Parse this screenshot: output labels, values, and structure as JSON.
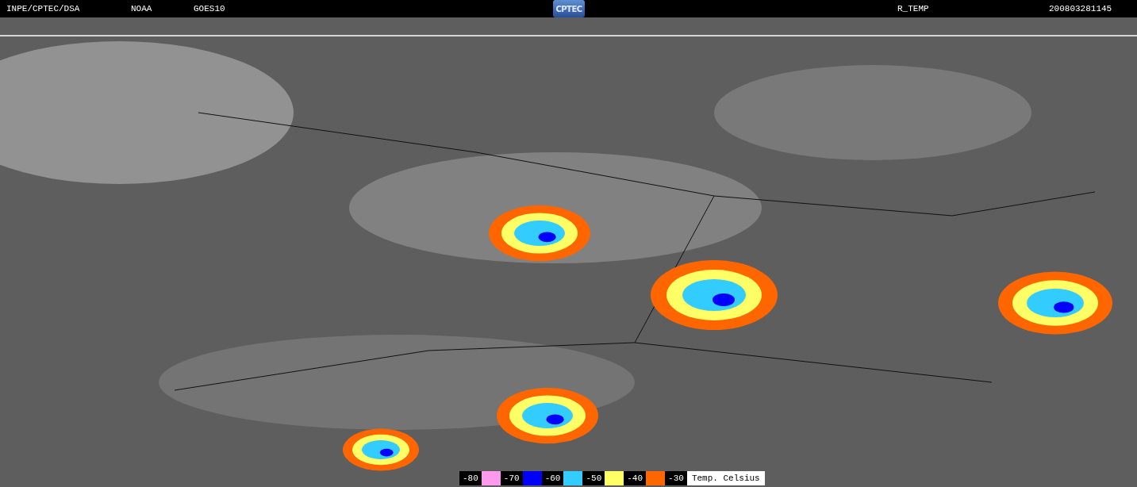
{
  "header": {
    "source": "INPE/CPTEC/DSA",
    "agency": "NOAA",
    "satellite": "GOES10",
    "logo": "CPTEC",
    "product": "R_TEMP",
    "timestamp": "200803281145"
  },
  "legend": {
    "bins": [
      {
        "label": "-80",
        "color": "#ff99ee"
      },
      {
        "label": "-70",
        "color": "#0000ff"
      },
      {
        "label": "-60",
        "color": "#33ccff"
      },
      {
        "label": "-50",
        "color": "#ffff66"
      },
      {
        "label": "-40",
        "color": "#ff6600"
      }
    ],
    "last_label": "-30",
    "unit": "Temp. Celsius"
  }
}
